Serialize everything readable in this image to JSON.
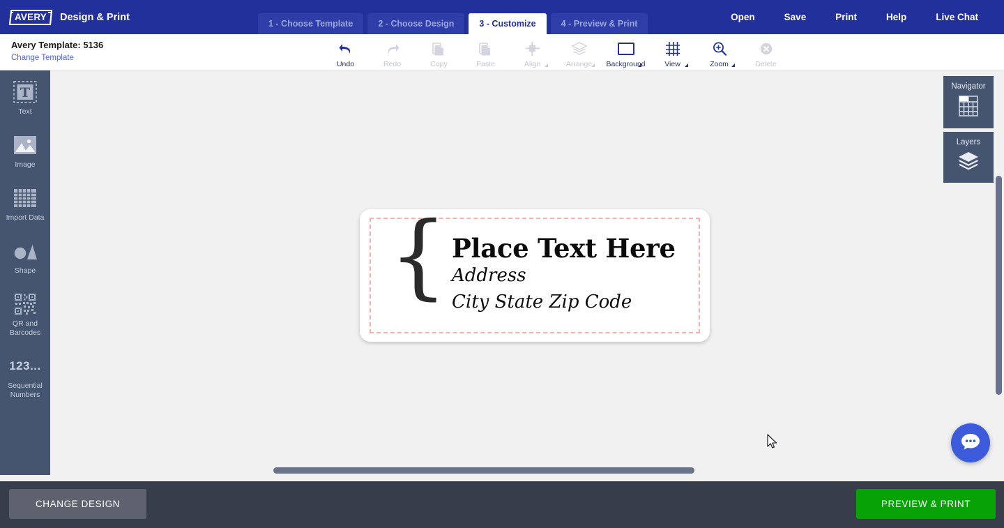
{
  "header": {
    "logo_text": "AVERY",
    "app_title": "Design & Print",
    "steps": [
      {
        "label": "1 - Choose Template",
        "active": false
      },
      {
        "label": "2 - Choose Design",
        "active": false
      },
      {
        "label": "3 - Customize",
        "active": true
      },
      {
        "label": "4 - Preview & Print",
        "active": false
      }
    ],
    "menu": [
      "Open",
      "Save",
      "Print",
      "Help",
      "Live Chat"
    ]
  },
  "template_bar": {
    "title": "Avery Template: 5136",
    "change_link": "Change Template"
  },
  "toolbar": [
    {
      "label": "Undo",
      "icon": "undo-icon",
      "enabled": true,
      "caret": false
    },
    {
      "label": "Redo",
      "icon": "redo-icon",
      "enabled": false,
      "caret": false
    },
    {
      "label": "Copy",
      "icon": "copy-icon",
      "enabled": false,
      "caret": false
    },
    {
      "label": "Paste",
      "icon": "paste-icon",
      "enabled": false,
      "caret": false
    },
    {
      "label": "Align",
      "icon": "align-icon",
      "enabled": false,
      "caret": true
    },
    {
      "label": "Arrange",
      "icon": "arrange-icon",
      "enabled": false,
      "caret": true
    },
    {
      "label": "Background",
      "icon": "background-icon",
      "enabled": true,
      "caret": true
    },
    {
      "label": "View",
      "icon": "grid-icon",
      "enabled": true,
      "caret": true
    },
    {
      "label": "Zoom",
      "icon": "zoom-in-icon",
      "enabled": true,
      "caret": true
    },
    {
      "label": "Delete",
      "icon": "delete-icon",
      "enabled": false,
      "caret": false
    }
  ],
  "sidebar": {
    "items": [
      {
        "label": "Text",
        "icon": "text-icon"
      },
      {
        "label": "Image",
        "icon": "image-icon"
      },
      {
        "label": "Import Data",
        "icon": "table-icon"
      },
      {
        "label": "Shape",
        "icon": "shape-icon"
      },
      {
        "label": "QR and Barcodes",
        "icon": "qr-code-icon"
      },
      {
        "label": "Sequential Numbers",
        "icon": "numbers-icon",
        "glyph": "123..."
      }
    ]
  },
  "canvas": {
    "label": {
      "title": "Place Text Here",
      "line2": "Address",
      "line3": "City State Zip Code",
      "brace_glyph": "{",
      "guide_color": "#f3b0b0"
    }
  },
  "right_panels": [
    {
      "label": "Navigator",
      "icon": "navigator-grid-icon"
    },
    {
      "label": "Layers",
      "icon": "layers-icon"
    }
  ],
  "chat": {
    "icon": "chat-bubble-icon"
  },
  "footer": {
    "change_design": "CHANGE DESIGN",
    "preview_print": "PREVIEW & PRINT"
  },
  "colors": {
    "brand_blue": "#22309c",
    "sidebar": "#45556f",
    "canvas_bg": "#f1f1f1",
    "footer_bg": "#383e49",
    "green_cta": "#06a206",
    "chat_blue": "#3b5bdb"
  }
}
